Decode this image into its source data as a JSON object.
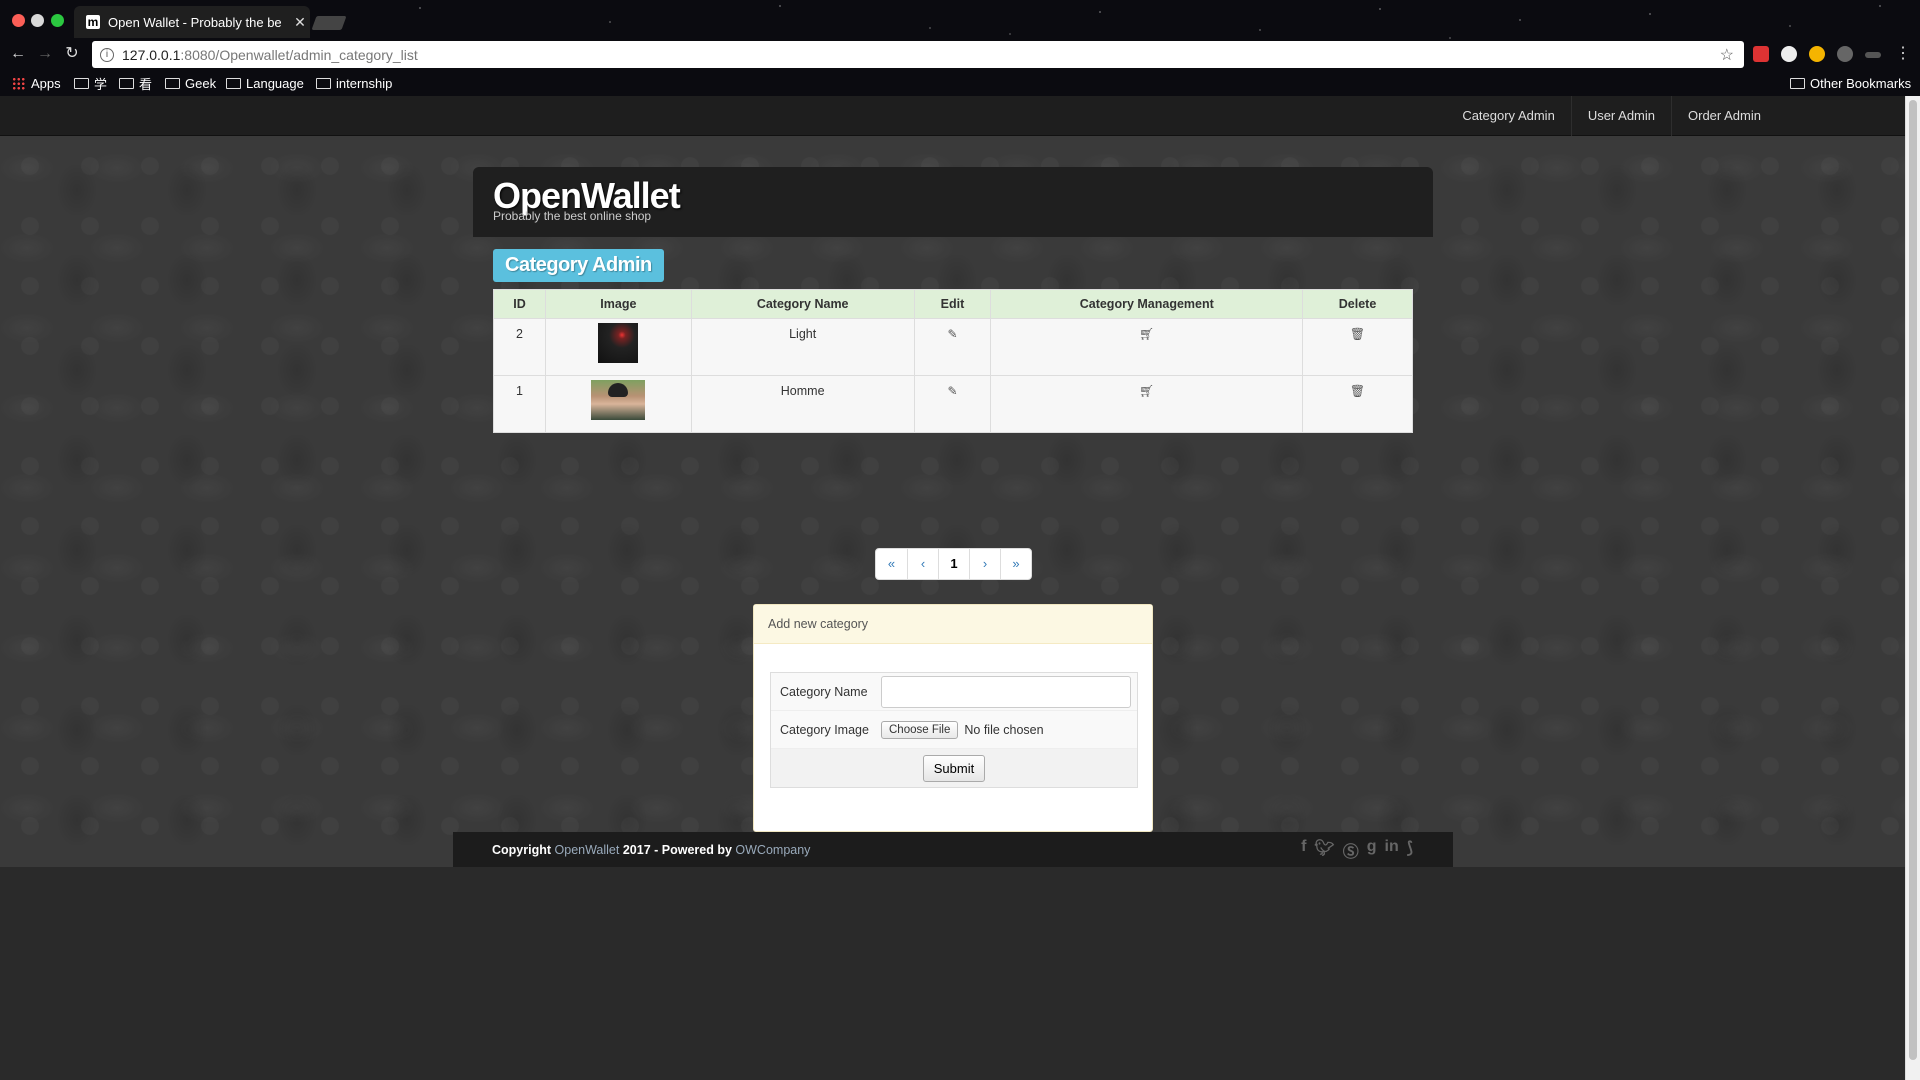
{
  "browser": {
    "tab_title": "Open Wallet - Probably the be",
    "tab_favicon": "m",
    "url_host": "127.0.0.1",
    "url_path": ":8080/Openwallet/admin_category_list",
    "bookmarks": [
      {
        "label": "Apps",
        "icon": "apps-grid-icon"
      },
      {
        "label": "学",
        "icon": "folder-icon"
      },
      {
        "label": "看",
        "icon": "folder-icon"
      },
      {
        "label": "Geek",
        "icon": "folder-icon"
      },
      {
        "label": "Language",
        "icon": "folder-icon"
      },
      {
        "label": "internship",
        "icon": "folder-icon"
      }
    ],
    "other_bookmarks": "Other Bookmarks"
  },
  "nav": {
    "links": [
      "Category Admin",
      "User Admin",
      "Order Admin"
    ]
  },
  "header": {
    "logo": "OpenWallet",
    "tagline": "Probably the best online shop"
  },
  "section_title": "Category Admin",
  "table": {
    "headers": [
      "ID",
      "Image",
      "Category Name",
      "Edit",
      "Category Management",
      "Delete"
    ],
    "rows": [
      {
        "id": "2",
        "image": "dark-night-photo",
        "name": "Light"
      },
      {
        "id": "1",
        "image": "person-portrait-photo",
        "name": "Homme"
      }
    ]
  },
  "pagination": {
    "first": "«",
    "prev": "‹",
    "current": "1",
    "next": "›",
    "last": "»"
  },
  "form": {
    "title": "Add new category",
    "name_label": "Category Name",
    "name_value": "",
    "image_label": "Category Image",
    "file_button": "Choose File",
    "file_status": "No file chosen",
    "submit": "Submit"
  },
  "footer": {
    "copyright_prefix": "Copyright",
    "brand": "OpenWallet",
    "middle": "2017 - Powered by",
    "company": "OWCompany",
    "social_icons": [
      "facebook-icon",
      "twitter-icon",
      "skype-icon",
      "google-icon",
      "linkedin-icon",
      "rss-icon"
    ]
  },
  "colors": {
    "title_badge": "#5bc0de",
    "table_header": "#dff0d8",
    "panel_header": "#fcf8e3"
  }
}
